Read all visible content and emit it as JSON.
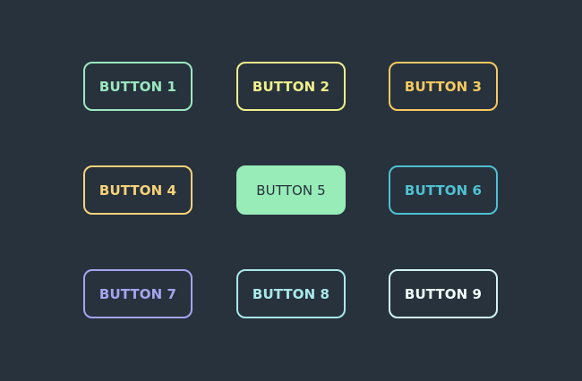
{
  "buttons": [
    {
      "label": "BUTTON 1",
      "color": "#9be8c0"
    },
    {
      "label": "BUTTON 2",
      "color": "#f0f08a"
    },
    {
      "label": "BUTTON 3",
      "color": "#f8c95f"
    },
    {
      "label": "BUTTON 4",
      "color": "#f8d27a"
    },
    {
      "label": "BUTTON 5",
      "color": "#97ecb7",
      "state": "filled"
    },
    {
      "label": "BUTTON 6",
      "color": "#4fc1d1"
    },
    {
      "label": "BUTTON 7",
      "color": "#a6a4f0"
    },
    {
      "label": "BUTTON 8",
      "color": "#a9e8ea"
    },
    {
      "label": "BUTTON 9",
      "color": "#d2f4f2"
    }
  ],
  "theme": {
    "background": "#27323d"
  }
}
